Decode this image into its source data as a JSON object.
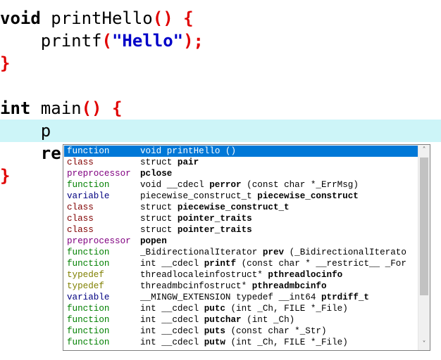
{
  "editor": {
    "lines": [
      {
        "parts": [
          {
            "t": "void",
            "c": "kw"
          },
          {
            "t": " printHello",
            "c": "fn"
          },
          {
            "t": "()",
            "c": "br"
          },
          {
            "t": " ",
            "c": "fn"
          },
          {
            "t": "{",
            "c": "br"
          }
        ]
      },
      {
        "parts": [
          {
            "t": "    printf",
            "c": "fn"
          },
          {
            "t": "(",
            "c": "br"
          },
          {
            "t": "\"Hello\"",
            "c": "str"
          },
          {
            "t": ");",
            "c": "br"
          }
        ]
      },
      {
        "parts": [
          {
            "t": "}",
            "c": "br"
          }
        ]
      },
      {
        "parts": []
      },
      {
        "parts": [
          {
            "t": "int",
            "c": "kw"
          },
          {
            "t": " main",
            "c": "fn"
          },
          {
            "t": "()",
            "c": "br"
          },
          {
            "t": " ",
            "c": "fn"
          },
          {
            "t": "{",
            "c": "br"
          }
        ]
      },
      {
        "parts": [
          {
            "t": "    p",
            "c": "fn"
          }
        ],
        "current": true
      },
      {
        "parts": [
          {
            "t": "    re",
            "c": "kw"
          }
        ]
      },
      {
        "parts": [
          {
            "t": "}",
            "c": "br"
          }
        ]
      }
    ]
  },
  "colors": {
    "function": "#008000",
    "class": "#800000",
    "preprocessor": "#800080",
    "variable": "#000080",
    "typedef": "#808000",
    "selection": "#0078d7"
  },
  "autocomplete": {
    "items": [
      {
        "kind": "function",
        "pre": "void ",
        "name": "printHello",
        "post": " ()",
        "selected": true
      },
      {
        "kind": "class",
        "pre": "struct ",
        "name": "pair",
        "post": ""
      },
      {
        "kind": "preprocessor",
        "pre": "",
        "name": "pclose",
        "post": ""
      },
      {
        "kind": "function",
        "pre": "void __cdecl ",
        "name": "perror",
        "post": " (const char *_ErrMsg)"
      },
      {
        "kind": "variable",
        "pre": "piecewise_construct_t ",
        "name": "piecewise_construct",
        "post": ""
      },
      {
        "kind": "class",
        "pre": "struct ",
        "name": "piecewise_construct_t",
        "post": ""
      },
      {
        "kind": "class",
        "pre": "struct ",
        "name": "pointer_traits",
        "post": ""
      },
      {
        "kind": "class",
        "pre": "struct ",
        "name": "pointer_traits",
        "post": ""
      },
      {
        "kind": "preprocessor",
        "pre": "",
        "name": "popen",
        "post": ""
      },
      {
        "kind": "function",
        "pre": "_BidirectionalIterator ",
        "name": "prev",
        "post": " (_BidirectionalIterato"
      },
      {
        "kind": "function",
        "pre": "int __cdecl ",
        "name": "printf",
        "post": " (const char * __restrict__ _For"
      },
      {
        "kind": "typedef",
        "pre": "threadlocaleinfostruct* ",
        "name": "pthreadlocinfo",
        "post": ""
      },
      {
        "kind": "typedef",
        "pre": "threadmbcinfostruct* ",
        "name": "pthreadmbcinfo",
        "post": ""
      },
      {
        "kind": "variable",
        "pre": "__MINGW_EXTENSION typedef __int64 ",
        "name": "ptrdiff_t",
        "post": ""
      },
      {
        "kind": "function",
        "pre": "int __cdecl ",
        "name": "putc",
        "post": " (int _Ch, FILE *_File)"
      },
      {
        "kind": "function",
        "pre": "int __cdecl ",
        "name": "putchar",
        "post": " (int _Ch)"
      },
      {
        "kind": "function",
        "pre": "int __cdecl ",
        "name": "puts",
        "post": " (const char *_Str)"
      },
      {
        "kind": "function",
        "pre": "int __cdecl ",
        "name": "putw",
        "post": " (int _Ch, FILE *_File)"
      }
    ]
  },
  "scrollbar": {
    "up_icon": "˄",
    "down_icon": "˅"
  }
}
